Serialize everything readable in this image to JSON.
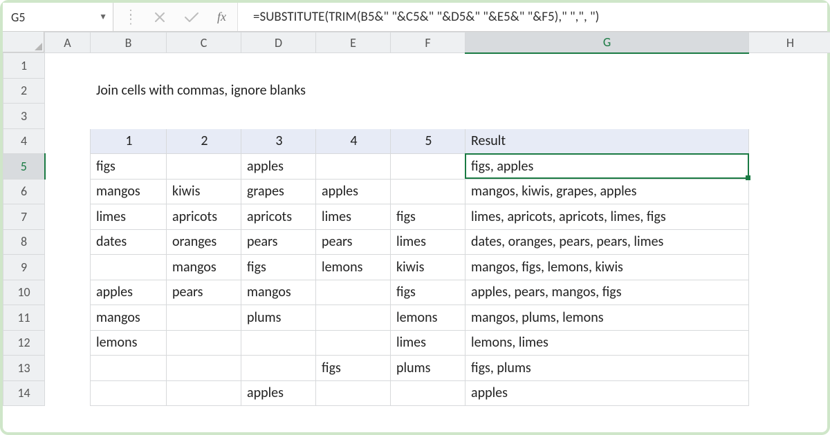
{
  "name_box": {
    "value": "G5"
  },
  "formula_bar": {
    "fx_label": "fx",
    "formula": "=SUBSTITUTE(TRIM(B5&\" \"&C5&\" \"&D5&\" \"&E5&\" \"&F5),\" \",\", \")"
  },
  "columns": [
    "A",
    "B",
    "C",
    "D",
    "E",
    "F",
    "G",
    "H"
  ],
  "row_numbers": [
    "1",
    "2",
    "3",
    "4",
    "5",
    "6",
    "7",
    "8",
    "9",
    "10",
    "11",
    "12",
    "13",
    "14"
  ],
  "title": "Join cells with commas, ignore blanks",
  "table": {
    "headers": {
      "c1": "1",
      "c2": "2",
      "c3": "3",
      "c4": "4",
      "c5": "5",
      "result": "Result"
    },
    "rows": [
      {
        "c1": "figs",
        "c2": "",
        "c3": "apples",
        "c4": "",
        "c5": "",
        "result": "figs, apples"
      },
      {
        "c1": "mangos",
        "c2": "kiwis",
        "c3": "grapes",
        "c4": "apples",
        "c5": "",
        "result": "mangos, kiwis, grapes, apples"
      },
      {
        "c1": "limes",
        "c2": "apricots",
        "c3": "apricots",
        "c4": "limes",
        "c5": "figs",
        "result": "limes, apricots, apricots, limes, figs"
      },
      {
        "c1": "dates",
        "c2": "oranges",
        "c3": "pears",
        "c4": "pears",
        "c5": "limes",
        "result": "dates, oranges, pears, pears, limes"
      },
      {
        "c1": "",
        "c2": "mangos",
        "c3": "figs",
        "c4": "lemons",
        "c5": "kiwis",
        "result": "mangos, figs, lemons, kiwis"
      },
      {
        "c1": "apples",
        "c2": "pears",
        "c3": "mangos",
        "c4": "",
        "c5": "figs",
        "result": "apples, pears, mangos, figs"
      },
      {
        "c1": "mangos",
        "c2": "",
        "c3": "plums",
        "c4": "",
        "c5": "lemons",
        "result": "mangos, plums, lemons"
      },
      {
        "c1": "lemons",
        "c2": "",
        "c3": "",
        "c4": "",
        "c5": "limes",
        "result": "lemons, limes"
      },
      {
        "c1": "",
        "c2": "",
        "c3": "",
        "c4": "figs",
        "c5": "plums",
        "result": "figs, plums"
      },
      {
        "c1": "",
        "c2": "",
        "c3": "apples",
        "c4": "",
        "c5": "",
        "result": "apples"
      }
    ]
  },
  "selection": {
    "active_cell": "G5",
    "active_column": "G",
    "active_row": "5"
  }
}
